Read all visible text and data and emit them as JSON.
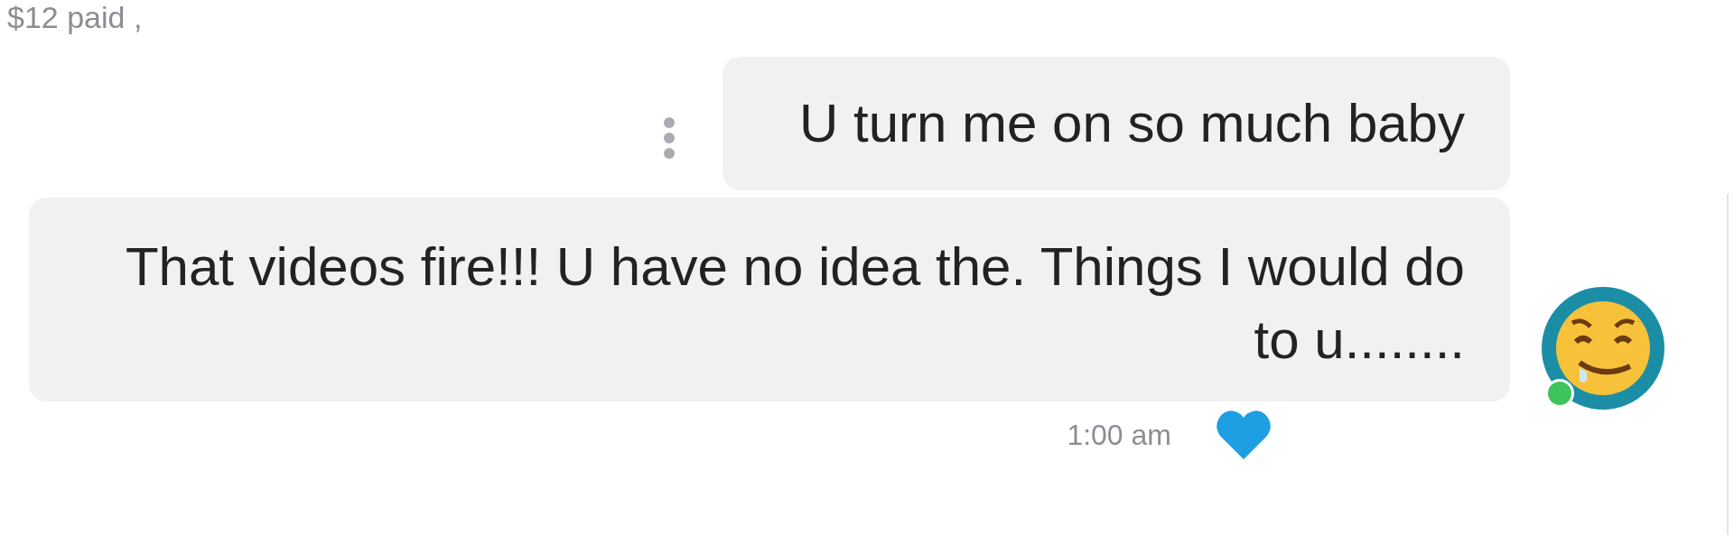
{
  "previous_message": {
    "status": "$12 paid ,"
  },
  "messages": [
    {
      "kind": "outgoing",
      "text": "U turn me on so much baby",
      "has_menu": true
    },
    {
      "kind": "incoming",
      "text": "That videos fire!!! U have no idea the. Things I would do to u........",
      "avatar": {
        "online": true
      },
      "liked": true,
      "time": "1:00 am"
    }
  ]
}
